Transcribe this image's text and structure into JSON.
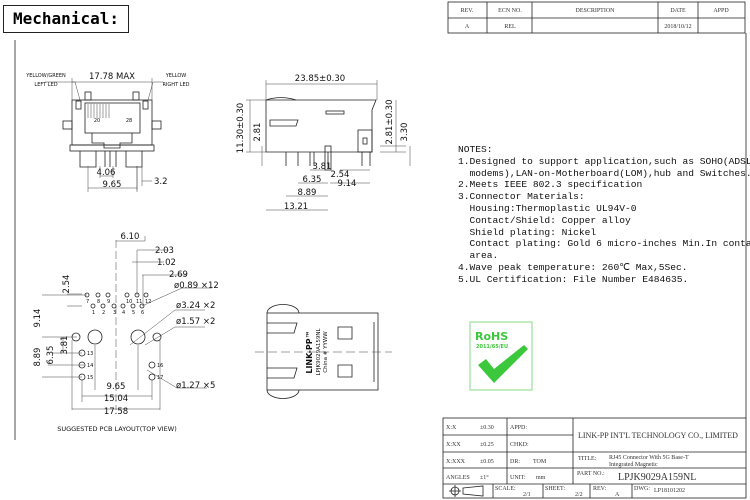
{
  "header": {
    "title": "Mechanical:"
  },
  "revision_table": {
    "headers": [
      "REV.",
      "ECN NO.",
      "DESCRIPTION",
      "DATE",
      "APPD"
    ],
    "rows": [
      [
        "A",
        "REL",
        "",
        "2018/10/12",
        ""
      ]
    ]
  },
  "front_view": {
    "left_led_1": "YELLOW/GREEN",
    "left_led_2": "LEFT LED",
    "right_led_1": "YELLOW",
    "right_led_2": "RIGHT LED",
    "pin_a": "20",
    "pin_b": "28",
    "dims": [
      "17.78 MAX",
      "4.06",
      "3.2",
      "9.65"
    ]
  },
  "side_view": {
    "dims": [
      "23.85±0.30",
      "11.30±0.30",
      "2.81",
      "2.81±0.30",
      "3.30",
      "3.81",
      "2.54",
      "6.35",
      "9.14",
      "8.89",
      "13.21"
    ]
  },
  "pcb_layout": {
    "caption": "SUGGESTED PCB LAYOUT(TOP VIEW)",
    "dims": [
      "6.10",
      "2.03",
      "1.02",
      "2.69",
      "2.54",
      "9.14",
      "8.89",
      "6.35",
      "3.81",
      "9.65",
      "15.04",
      "17.58"
    ],
    "callouts": [
      "ø0.89 ×12",
      "ø3.24 ×2",
      "ø1.57 ×2",
      "ø1.27 ×5"
    ],
    "pin_labels": [
      "7",
      "8",
      "9",
      "10",
      "11",
      "12",
      "1",
      "2",
      "3",
      "4",
      "5",
      "6",
      "13",
      "14",
      "15",
      "16",
      "17"
    ]
  },
  "top_view": {
    "brand": "LINK-PP™",
    "part": "LPJK9029A159NL",
    "origin": "China # YYWW"
  },
  "notes": {
    "heading": "NOTES:",
    "lines": [
      "1.Designed to support application,such as SOHO(ADSL",
      "  modems),LAN-on-Motherboard(LOM),hub and Switches.",
      "2.Meets IEEE 802.3 specification",
      "3.Connector Materials:",
      "  Housing:Thermoplastic UL94V-0",
      "  Contact/Shield: Copper alloy",
      "  Shield plating: Nickel",
      "  Contact plating: Gold 6 micro-inches Min.In contact",
      "  area.",
      "4.Wave peak temperature: 260℃ Max,5Sec.",
      "5.UL Certification: File Number E484635."
    ]
  },
  "rohs": {
    "label": "RoHS",
    "directive": "2011/65/EU",
    "color": "#3cc83c"
  },
  "title_block": {
    "tolerances": [
      [
        "X:X",
        "±0.30"
      ],
      [
        "X:XX",
        "±0.25"
      ],
      [
        "X:XXX",
        "±0.05"
      ],
      [
        "ANGLES",
        "±1°"
      ]
    ],
    "appd_label": "APPD:",
    "chkd_label": "CHKD:",
    "dr_label": "DR:",
    "dr_value": "TOM",
    "unit_label": "UNIT:",
    "unit_value": "mm",
    "company": "LINK-PP INT'L TECHNOLOGY CO., LIMITED",
    "title_label": "TITLE:",
    "title_line1": "RJ45 Connector With 5G Base-T",
    "title_line2": "Integrated Magnetic",
    "part_label": "PART NO.:",
    "part_no": "LPJK9029A159NL",
    "scale_label": "SCALE:",
    "scale": "2/1",
    "sheet_label": "SHEET:",
    "sheet": "2/2",
    "rev_label": "REV:",
    "rev": "A",
    "dwg_label": "DWG:",
    "dwg": "LP18101202"
  }
}
